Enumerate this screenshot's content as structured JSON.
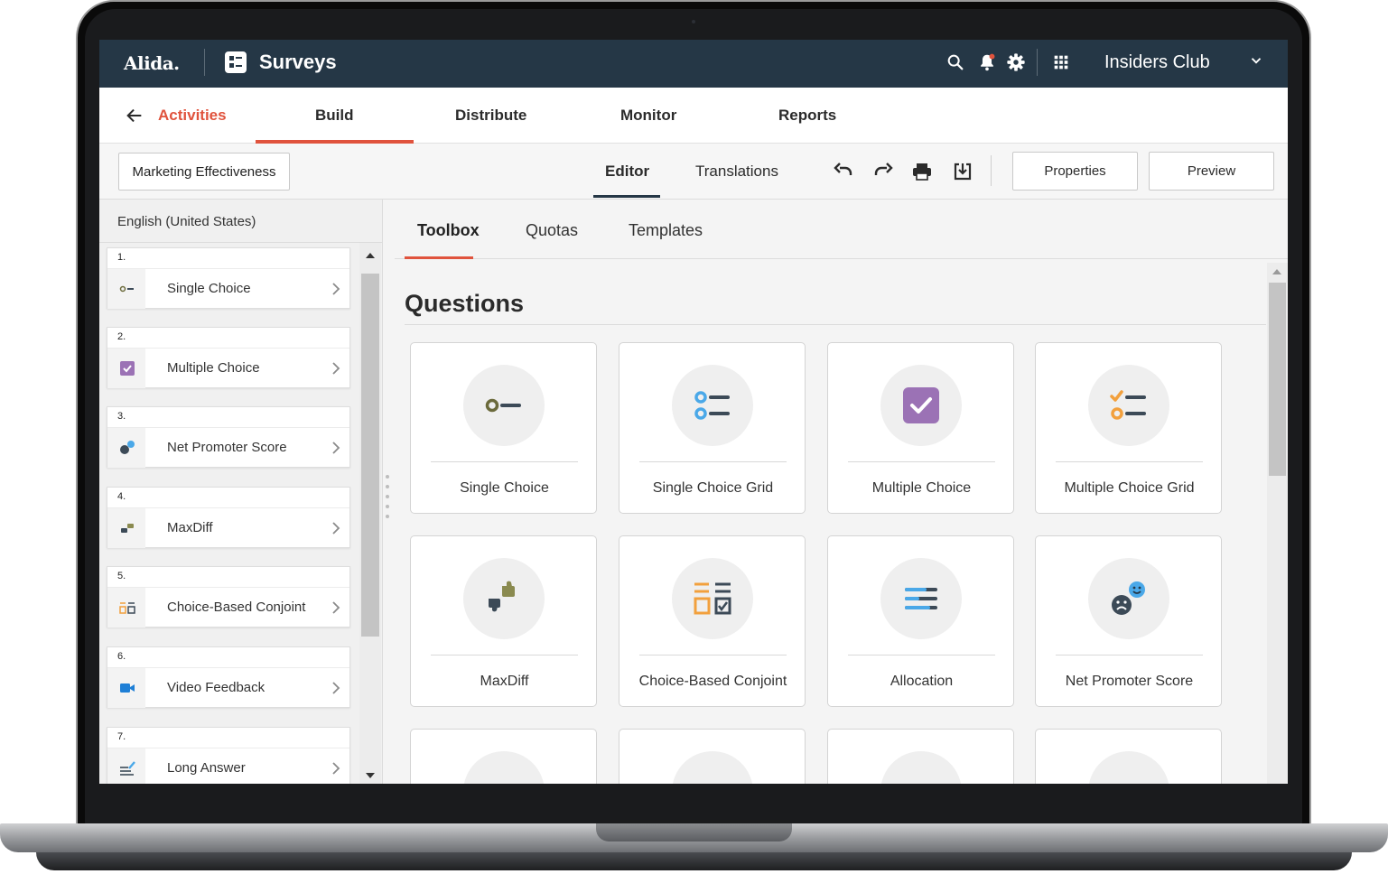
{
  "topbar": {
    "logo": "Alida.",
    "app_name": "Surveys",
    "org_name": "Insiders Club",
    "icons": [
      "search-icon",
      "notification-bell-icon",
      "settings-gear-icon",
      "app-grid-icon",
      "chevron-down-icon"
    ]
  },
  "nav": {
    "back_label": "Activities",
    "tabs": [
      "Build",
      "Distribute",
      "Monitor",
      "Reports"
    ],
    "active_tab": "Build"
  },
  "toolbar": {
    "survey_name": "Marketing Effectiveness",
    "tabs": [
      "Editor",
      "Translations"
    ],
    "active_tab": "Editor",
    "icons": [
      "undo-icon",
      "redo-icon",
      "print-icon",
      "download-icon"
    ],
    "properties_label": "Properties",
    "preview_label": "Preview"
  },
  "left_panel": {
    "language": "English (United States)",
    "questions": [
      {
        "num": "1.",
        "label": "Single Choice",
        "icon": "single-choice-icon"
      },
      {
        "num": "2.",
        "label": "Multiple Choice",
        "icon": "checkbox-icon"
      },
      {
        "num": "3.",
        "label": "Net Promoter Score",
        "icon": "nps-faces-icon"
      },
      {
        "num": "4.",
        "label": "MaxDiff",
        "icon": "thumbs-icon"
      },
      {
        "num": "5.",
        "label": "Choice-Based Conjoint",
        "icon": "conjoint-icon"
      },
      {
        "num": "6.",
        "label": "Video Feedback",
        "icon": "video-camera-icon"
      },
      {
        "num": "7.",
        "label": "Long Answer",
        "icon": "long-answer-icon"
      }
    ]
  },
  "right_panel": {
    "tabs": [
      "Toolbox",
      "Quotas",
      "Templates"
    ],
    "active_tab": "Toolbox",
    "section_title": "Questions",
    "tiles": [
      {
        "label": "Single Choice",
        "icon": "single-choice-icon"
      },
      {
        "label": "Single Choice Grid",
        "icon": "single-choice-grid-icon"
      },
      {
        "label": "Multiple Choice",
        "icon": "checkbox-icon"
      },
      {
        "label": "Multiple Choice Grid",
        "icon": "multiple-choice-grid-icon"
      },
      {
        "label": "MaxDiff",
        "icon": "thumbs-icon"
      },
      {
        "label": "Choice-Based Conjoint",
        "icon": "conjoint-icon"
      },
      {
        "label": "Allocation",
        "icon": "allocation-icon"
      },
      {
        "label": "Net Promoter Score",
        "icon": "nps-faces-icon"
      }
    ]
  },
  "colors": {
    "topbar": "#253746",
    "accent": "#e0533d",
    "olive": "#6b6a3b",
    "purple": "#9b72b5",
    "blue": "#4aa8e8",
    "orange": "#f2a03d",
    "slate": "#3c4a57"
  }
}
